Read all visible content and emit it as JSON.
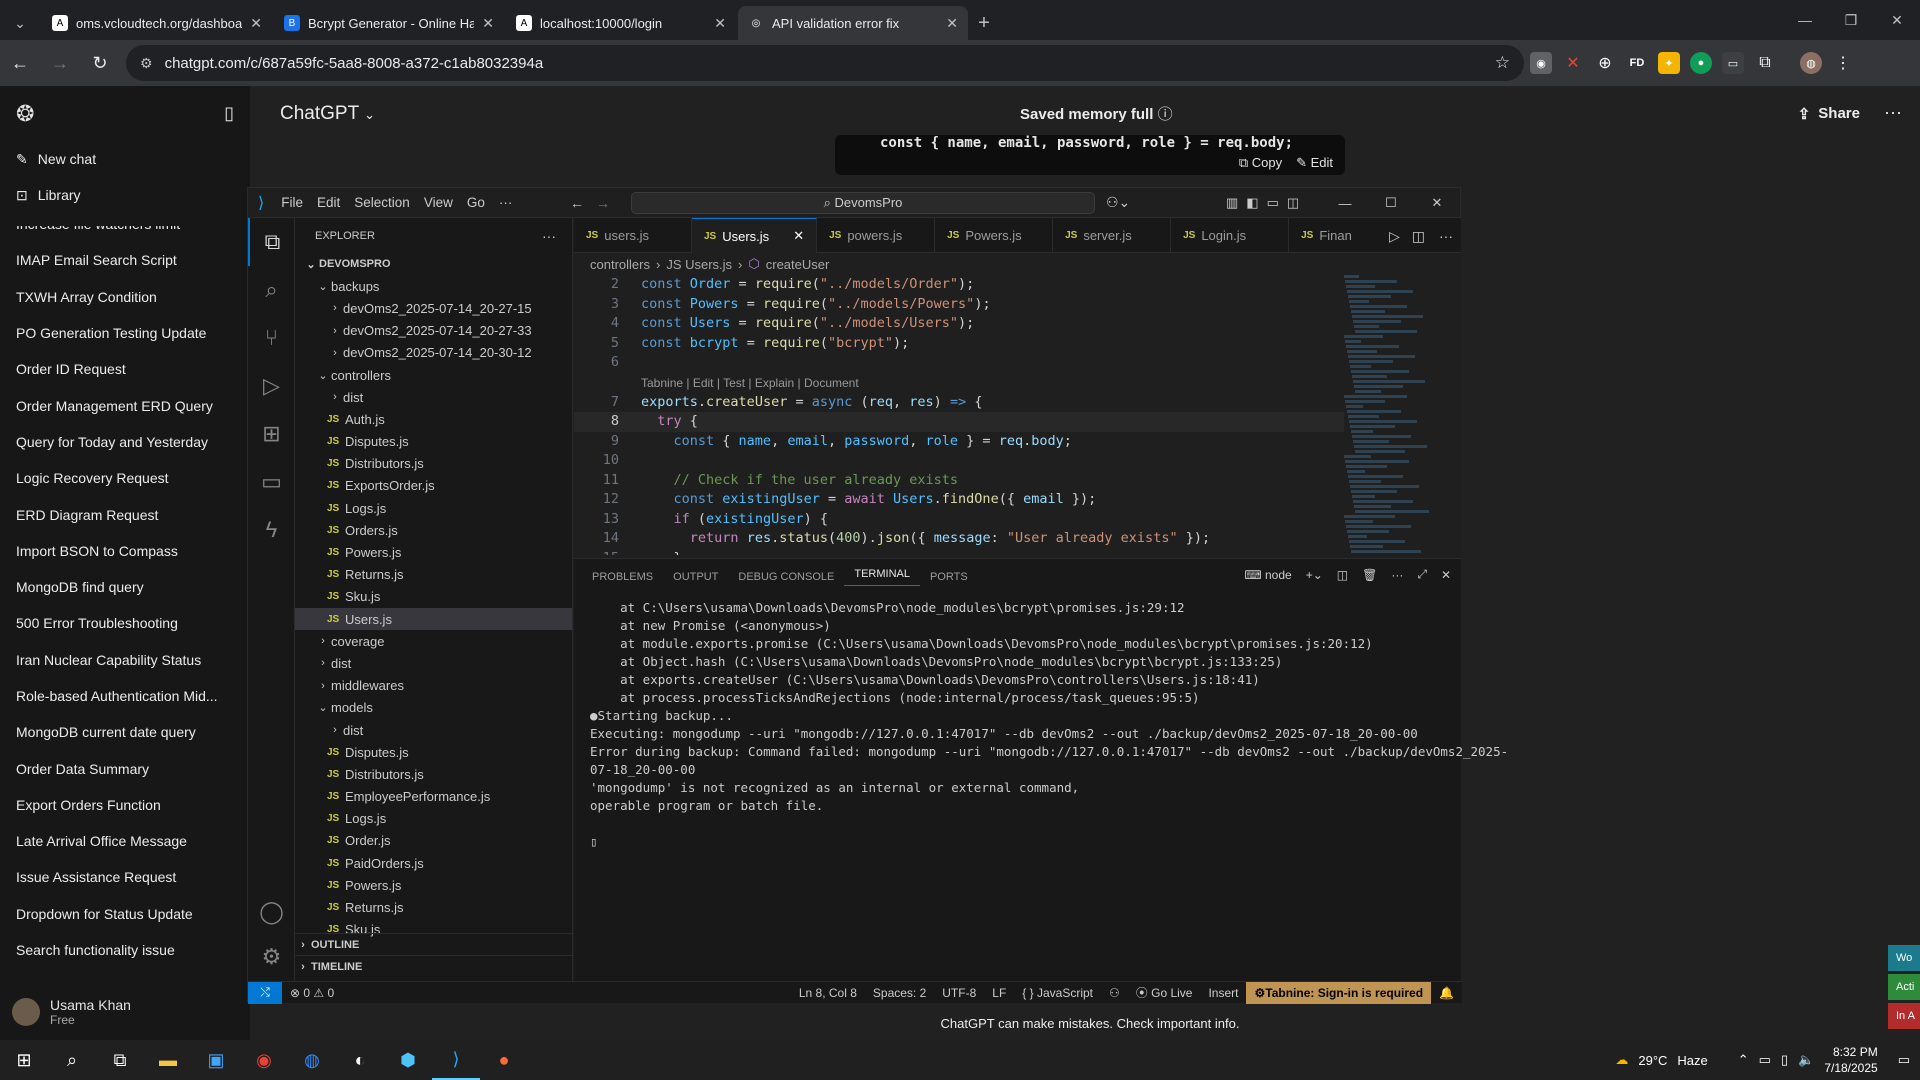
{
  "browser": {
    "tabs": [
      {
        "title": "oms.vcloudtech.org/dashboard",
        "icon": "A"
      },
      {
        "title": "Bcrypt Generator - Online Hash",
        "icon": "B"
      },
      {
        "title": "localhost:10000/login",
        "icon": "A"
      },
      {
        "title": "API validation error fix",
        "icon": "◎"
      }
    ],
    "url": "chatgpt.com/c/687a59fc-5aa8-8008-a372-c1ab8032394a"
  },
  "chatgpt": {
    "new_chat": "New chat",
    "library": "Library",
    "history": [
      "Increase file watchers limit",
      "IMAP Email Search Script",
      "TXWH Array Condition",
      "PO Generation Testing Update",
      "Order ID Request",
      "Order Management ERD Query",
      "Query for Today and Yesterday",
      "Logic Recovery Request",
      "ERD Diagram Request",
      "Import BSON to Compass",
      "MongoDB find query",
      "500 Error Troubleshooting",
      "Iran Nuclear Capability Status",
      "Role-based Authentication Mid...",
      "MongoDB current date query",
      "Order Data Summary",
      "Export Orders Function",
      "Late Arrival Office Message",
      "Issue Assistance Request",
      "Dropdown for Status Update",
      "Search functionality issue"
    ],
    "user_name": "Usama Khan",
    "user_plan": "Free",
    "title": "ChatGPT",
    "saved_memory": "Saved memory full",
    "share": "Share",
    "snippet": "const { name, email, password, role } = req.body;",
    "copy": "Copy",
    "edit": "Edit",
    "disclaimer": "ChatGPT can make mistakes. Check important info."
  },
  "vscode": {
    "menus": [
      "File",
      "Edit",
      "Selection",
      "View",
      "Go",
      "···"
    ],
    "search": "DevomsPro",
    "explorer_title": "EXPLORER",
    "tree": [
      {
        "label": "DEVOMSPRO",
        "indent": 0,
        "type": "root"
      },
      {
        "label": "backups",
        "indent": 1,
        "type": "open"
      },
      {
        "label": "devOms2_2025-07-14_20-27-15",
        "indent": 2,
        "type": "closed"
      },
      {
        "label": "devOms2_2025-07-14_20-27-33",
        "indent": 2,
        "type": "closed"
      },
      {
        "label": "devOms2_2025-07-14_20-30-12",
        "indent": 2,
        "type": "closed"
      },
      {
        "label": "controllers",
        "indent": 1,
        "type": "open"
      },
      {
        "label": "dist",
        "indent": 2,
        "type": "closed"
      },
      {
        "label": "Auth.js",
        "indent": 2,
        "type": "js"
      },
      {
        "label": "Disputes.js",
        "indent": 2,
        "type": "js"
      },
      {
        "label": "Distributors.js",
        "indent": 2,
        "type": "js"
      },
      {
        "label": "ExportsOrder.js",
        "indent": 2,
        "type": "js"
      },
      {
        "label": "Logs.js",
        "indent": 2,
        "type": "js"
      },
      {
        "label": "Orders.js",
        "indent": 2,
        "type": "js"
      },
      {
        "label": "Powers.js",
        "indent": 2,
        "type": "js"
      },
      {
        "label": "Returns.js",
        "indent": 2,
        "type": "js"
      },
      {
        "label": "Sku.js",
        "indent": 2,
        "type": "js"
      },
      {
        "label": "Users.js",
        "indent": 2,
        "type": "js",
        "sel": true
      },
      {
        "label": "coverage",
        "indent": 1,
        "type": "closed"
      },
      {
        "label": "dist",
        "indent": 1,
        "type": "closed"
      },
      {
        "label": "middlewares",
        "indent": 1,
        "type": "closed"
      },
      {
        "label": "models",
        "indent": 1,
        "type": "open"
      },
      {
        "label": "dist",
        "indent": 2,
        "type": "closed"
      },
      {
        "label": "Disputes.js",
        "indent": 2,
        "type": "js"
      },
      {
        "label": "Distributors.js",
        "indent": 2,
        "type": "js"
      },
      {
        "label": "EmployeePerformance.js",
        "indent": 2,
        "type": "js"
      },
      {
        "label": "Logs.js",
        "indent": 2,
        "type": "js"
      },
      {
        "label": "Order.js",
        "indent": 2,
        "type": "js"
      },
      {
        "label": "PaidOrders.js",
        "indent": 2,
        "type": "js"
      },
      {
        "label": "Powers.js",
        "indent": 2,
        "type": "js"
      },
      {
        "label": "Returns.js",
        "indent": 2,
        "type": "js"
      },
      {
        "label": "Sku.js",
        "indent": 2,
        "type": "js"
      }
    ],
    "outline": "OUTLINE",
    "timeline": "TIMELINE",
    "tabs": [
      "users.js",
      "Users.js",
      "powers.js",
      "Powers.js",
      "server.js",
      "Login.js",
      "Finan"
    ],
    "breadcrumb": [
      "controllers",
      "JS Users.js",
      "createUser"
    ],
    "codelens": "Tabnine | Edit | Test | Explain | Document",
    "panel_tabs": [
      "PROBLEMS",
      "OUTPUT",
      "DEBUG CONSOLE",
      "TERMINAL",
      "PORTS"
    ],
    "terminal_shell": "node",
    "terminal": [
      "    at C:\\Users\\usama\\Downloads\\DevomsPro\\node_modules\\bcrypt\\promises.js:29:12",
      "    at new Promise (<anonymous>)",
      "    at module.exports.promise (C:\\Users\\usama\\Downloads\\DevomsPro\\node_modules\\bcrypt\\promises.js:20:12)",
      "    at Object.hash (C:\\Users\\usama\\Downloads\\DevomsPro\\node_modules\\bcrypt\\bcrypt.js:133:25)",
      "    at exports.createUser (C:\\Users\\usama\\Downloads\\DevomsPro\\controllers\\Users.js:18:41)",
      "    at process.processTicksAndRejections (node:internal/process/task_queues:95:5)",
      "●Starting backup...",
      "Executing: mongodump --uri \"mongodb://127.0.0.1:47017\" --db devOms2 --out ./backup/devOms2_2025-07-18_20-00-00",
      "Error during backup: Command failed: mongodump --uri \"mongodb://127.0.0.1:47017\" --db devOms2 --out ./backup/devOms2_2025-",
      "07-18_20-00-00",
      "'mongodump' is not recognized as an internal or external command,",
      "operable program or batch file.",
      "",
      "▯"
    ],
    "status": {
      "errors": "⊗ 0 ⚠ 0",
      "pos": "Ln 8, Col 8",
      "spaces": "Spaces: 2",
      "enc": "UTF-8",
      "eol": "LF",
      "lang": "{ } JavaScript",
      "golive": "Go Live",
      "insert": "Insert",
      "tabnine": "Tabnine: Sign-in is required"
    }
  },
  "taskbar": {
    "weather": "29°C",
    "haze": "Haze",
    "time": "8:32 PM",
    "date": "7/18/2025"
  },
  "widgets": [
    "Wo",
    "Acti",
    "In A"
  ],
  "colors": {
    "accent": "#0078d4",
    "tabnine": "#c09553"
  }
}
